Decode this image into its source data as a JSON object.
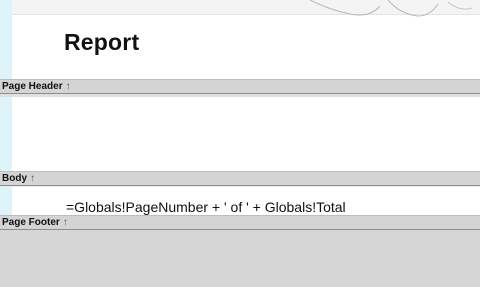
{
  "report": {
    "title": "Report",
    "sections": {
      "page_header": {
        "label": "Page Header",
        "marker": "↑"
      },
      "body": {
        "label": "Body",
        "marker": "↑"
      },
      "page_footer": {
        "label": "Page Footer",
        "marker": "↑"
      }
    },
    "body_expression": "=Globals!PageNumber + ' of ' + Globals!Total"
  },
  "colors": {
    "band": "#d4d4d4",
    "ruler": "#dff3fb",
    "footer_area": "#d6d6d6"
  }
}
